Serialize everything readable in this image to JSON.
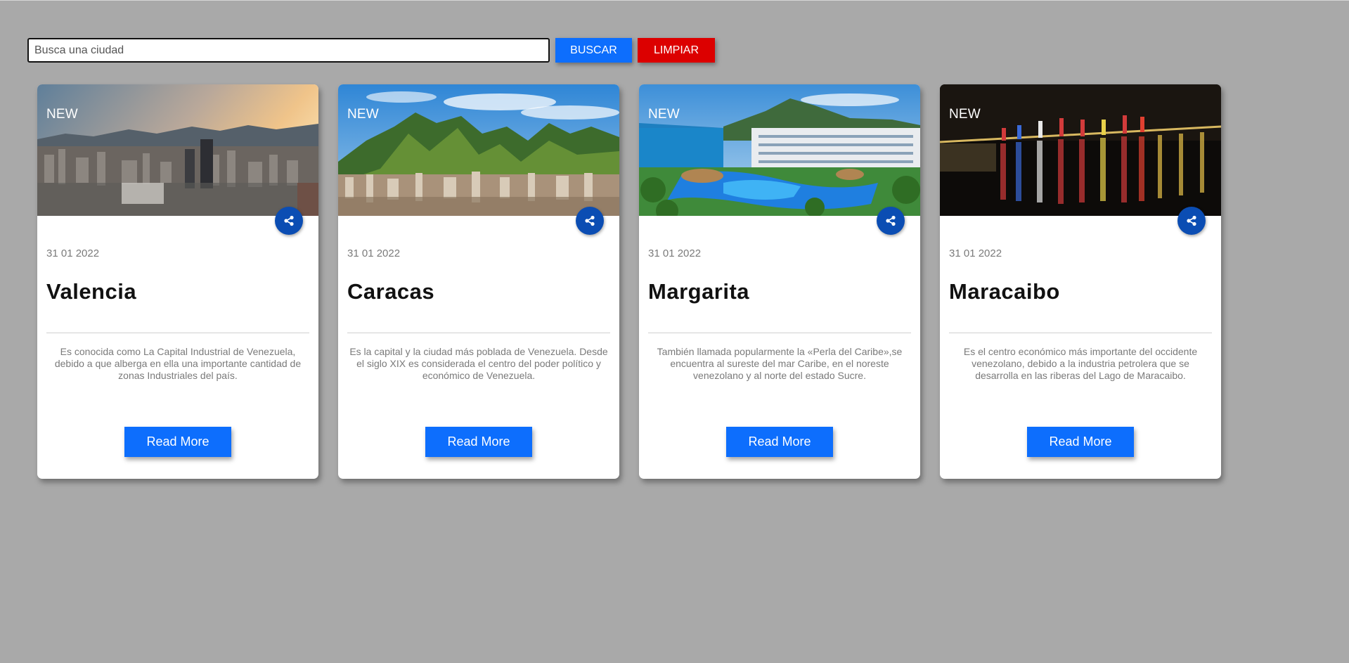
{
  "search": {
    "placeholder": "Busca una ciudad",
    "value": "",
    "buscar_label": "BUSCAR",
    "limpiar_label": "LIMPIAR"
  },
  "colors": {
    "background": "#a9a9a9",
    "primary": "#0d6efd",
    "danger": "#dc0000",
    "share": "#0b4db3"
  },
  "cards": [
    {
      "badge": "NEW",
      "date": "31 01 2022",
      "title": "Valencia",
      "description": "Es conocida como La Capital Industrial de Venezuela, debido a que alberga en ella una importante cantidad de zonas Industriales del país.",
      "button": "Read More",
      "share_icon": "share-icon"
    },
    {
      "badge": "NEW",
      "date": "31 01 2022",
      "title": "Caracas",
      "description": "Es la capital y la ciudad más poblada de Venezuela. Desde el siglo XIX es considerada el centro del poder político y económico de Venezuela.",
      "button": "Read More",
      "share_icon": "share-icon"
    },
    {
      "badge": "NEW",
      "date": "31 01 2022",
      "title": "Margarita",
      "description": "También llamada popularmente la «Perla del Caribe»,se encuentra al sureste del mar Caribe, en el noreste venezolano y al norte del estado Sucre.",
      "button": "Read More",
      "share_icon": "share-icon"
    },
    {
      "badge": "NEW",
      "date": "31 01 2022",
      "title": "Maracaibo",
      "description": "Es el centro económico más importante del occidente venezolano, debido a la industria petrolera que se desarrolla en las riberas del Lago de Maracaibo.",
      "button": "Read More",
      "share_icon": "share-icon"
    }
  ]
}
